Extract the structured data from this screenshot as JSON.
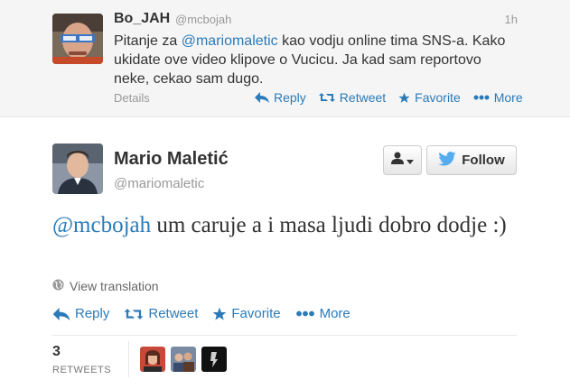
{
  "parent_tweet": {
    "name": "Bo_JAH",
    "handle": "@mcbojah",
    "time": "1h",
    "text_prefix": "Pitanje za ",
    "mention": "@mariomaletic",
    "text_suffix": " kao vodju online tima SNS-a. Kako ukidate ove video klipove o Vucicu. Ja kad sam reportovo neke, cekao sam dugo.",
    "details_label": "Details",
    "actions": {
      "reply": "Reply",
      "retweet": "Retweet",
      "favorite": "Favorite",
      "more": "More"
    }
  },
  "main_tweet": {
    "name": "Mario Maletić",
    "handle": "@mariomaletic",
    "follow_label": "Follow",
    "mention": "@mcbojah",
    "text": " um caruje a i masa ljudi dobro dodje :)",
    "view_translation": "View translation",
    "actions": {
      "reply": "Reply",
      "retweet": "Retweet",
      "favorite": "Favorite",
      "more": "More"
    },
    "stats": {
      "retweet_count": "3",
      "retweet_label": "RETWEETS"
    }
  },
  "colors": {
    "link": "#2b7bb9",
    "parent_background": "#f5f5f5",
    "twitter_bird": "#55acee"
  },
  "icons": [
    "reply-icon",
    "retweet-icon",
    "favorite-icon",
    "more-icon",
    "globe-icon",
    "user-icon",
    "caret-down-icon",
    "twitter-bird-icon"
  ]
}
